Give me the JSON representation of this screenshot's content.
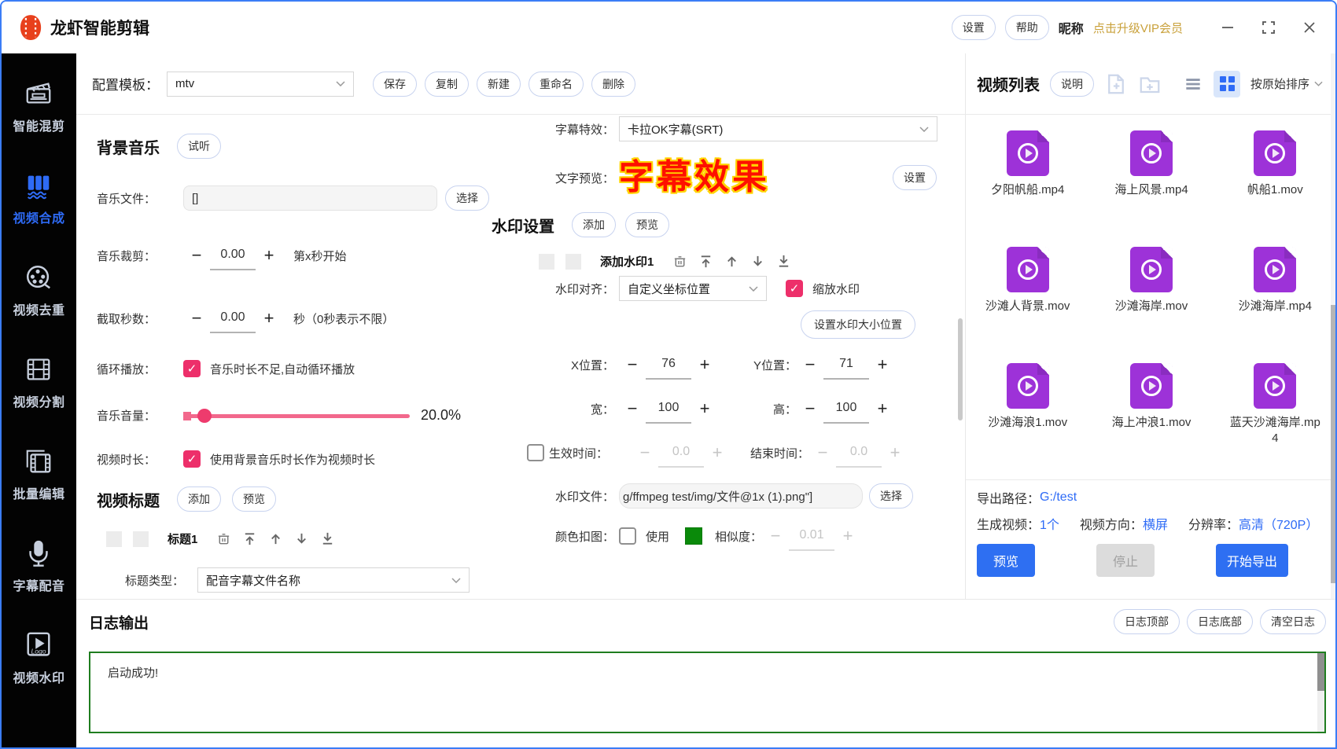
{
  "colors": {
    "accent_blue": "#2e6bf6",
    "checkbox_pink": "#ed2f6a",
    "slider_pink": "#f2688c",
    "file_purple": "#9d32d8",
    "vip_gold": "#c9a13b",
    "log_green": "#1f7d1f",
    "preview_red": "#fe1000",
    "preview_outline_yellow": "#ffd400",
    "chroma_green": "#0a8a0a"
  },
  "titlebar": {
    "app_title": "龙虾智能剪辑",
    "settings": "设置",
    "help": "帮助",
    "nickname": "昵称",
    "vip": "点击升级VIP会员"
  },
  "sidebar": {
    "items": [
      {
        "label": "智能混剪"
      },
      {
        "label": "视频合成"
      },
      {
        "label": "视频去重"
      },
      {
        "label": "视频分割"
      },
      {
        "label": "批量编辑"
      },
      {
        "label": "字幕配音"
      },
      {
        "label": "视频水印",
        "icon_text": "Logo"
      }
    ],
    "active_index": 1
  },
  "template_bar": {
    "label": "配置模板：",
    "value": "mtv",
    "save": "保存",
    "copy": "复制",
    "new": "新建",
    "rename": "重命名",
    "delete": "删除"
  },
  "music": {
    "heading": "背景音乐",
    "audition": "试听",
    "file_label": "音乐文件：",
    "file_value": "[]",
    "choose": "选择",
    "trim_label": "音乐裁剪：",
    "trim_value": "0.00",
    "trim_hint": "第x秒开始",
    "cut_label": "截取秒数：",
    "cut_value": "0.00",
    "cut_hint": "秒（0秒表示不限）",
    "loop_label": "循环播放：",
    "loop_hint": "音乐时长不足,自动循环播放",
    "volume_label": "音乐音量：",
    "volume_value": "20.0%",
    "duration_label": "视频时长：",
    "duration_hint": "使用背景音乐时长作为视频时长"
  },
  "video_title": {
    "heading": "视频标题",
    "add": "添加",
    "preview": "预览",
    "item_name": "标题1",
    "type_label": "标题类型：",
    "type_value": "配音字幕文件名称"
  },
  "subtitle": {
    "effect_label": "字幕特效：",
    "effect_value": "卡拉OK字幕(SRT)",
    "preview_label": "文字预览：",
    "preview_text": "字幕效果",
    "settings": "设置"
  },
  "watermark": {
    "heading": "水印设置",
    "add": "添加",
    "preview": "预览",
    "item_name": "添加水印1",
    "align_label": "水印对齐：",
    "align_value": "自定义坐标位置",
    "scale_label": "缩放水印",
    "size_pos_button": "设置水印大小位置",
    "x_label": "X位置：",
    "x_value": "76",
    "y_label": "Y位置：",
    "y_value": "71",
    "w_label": "宽：",
    "w_value": "100",
    "h_label": "高：",
    "h_value": "100",
    "start_label": "生效时间：",
    "start_value": "0.0",
    "end_label": "结束时间：",
    "end_value": "0.0",
    "file_label": "水印文件：",
    "file_value": "g/ffmpeg test/img/文件@1x (1).png\"]",
    "choose": "选择",
    "chroma_label": "颜色扣图：",
    "chroma_use": "使用",
    "similarity_label": "相似度：",
    "similarity_value": "0.01"
  },
  "video_list": {
    "heading": "视频列表",
    "info": "说明",
    "sort": "按原始排序",
    "files": [
      "夕阳帆船.mp4",
      "海上风景.mp4",
      "帆船1.mov",
      "沙滩人背景.mov",
      "沙滩海岸.mov",
      "沙滩海岸.mp4",
      "沙滩海浪1.mov",
      "海上冲浪1.mov",
      "蓝天沙滩海岸.mp4"
    ]
  },
  "export": {
    "path_label": "导出路径：",
    "path_value": "G:/test",
    "count_label": "生成视频：",
    "count_value": "1个",
    "orient_label": "视频方向：",
    "orient_value": "横屏",
    "res_label": "分辨率：",
    "res_value": "高清（720P）",
    "preview": "预览",
    "stop": "停止",
    "start": "开始导出"
  },
  "log": {
    "heading": "日志输出",
    "top": "日志顶部",
    "bottom": "日志底部",
    "clear": "清空日志",
    "content": "启动成功!"
  }
}
